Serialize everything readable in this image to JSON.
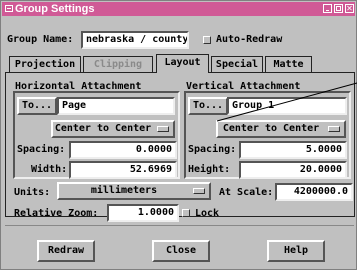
{
  "window": {
    "title": "Group Settings"
  },
  "top": {
    "group_name_label": "Group Name:",
    "group_name_value": "nebraska / county",
    "auto_redraw_label": "Auto-Redraw"
  },
  "tabs": [
    {
      "label": "Projection",
      "enabled": true
    },
    {
      "label": "Clipping",
      "enabled": false
    },
    {
      "label": "Layout",
      "enabled": true,
      "active": true
    },
    {
      "label": "Special",
      "enabled": true
    },
    {
      "label": "Matte",
      "enabled": true
    }
  ],
  "horizontal": {
    "title": "Horizontal Attachment",
    "to_button": "To...",
    "to_value": "Page",
    "mode": "Center to Center",
    "spacing_label": "Spacing:",
    "spacing_value": "0.0000",
    "size_label": "Width:",
    "size_value": "52.6969"
  },
  "vertical": {
    "title": "Vertical Attachment",
    "to_button": "To...",
    "to_value": "Group 1",
    "mode": "Center to Center",
    "spacing_label": "Spacing:",
    "spacing_value": "5.0000",
    "size_label": "Height:",
    "size_value": "20.0000"
  },
  "units": {
    "label": "Units:",
    "value": "millimeters",
    "scale_label": "At Scale:",
    "scale_value": "4200000.0"
  },
  "zoom": {
    "label": "Relative Zoom:",
    "value": "1.0000",
    "lock_label": "Lock"
  },
  "buttons": {
    "redraw": "Redraw",
    "close": "Close",
    "help": "Help"
  }
}
